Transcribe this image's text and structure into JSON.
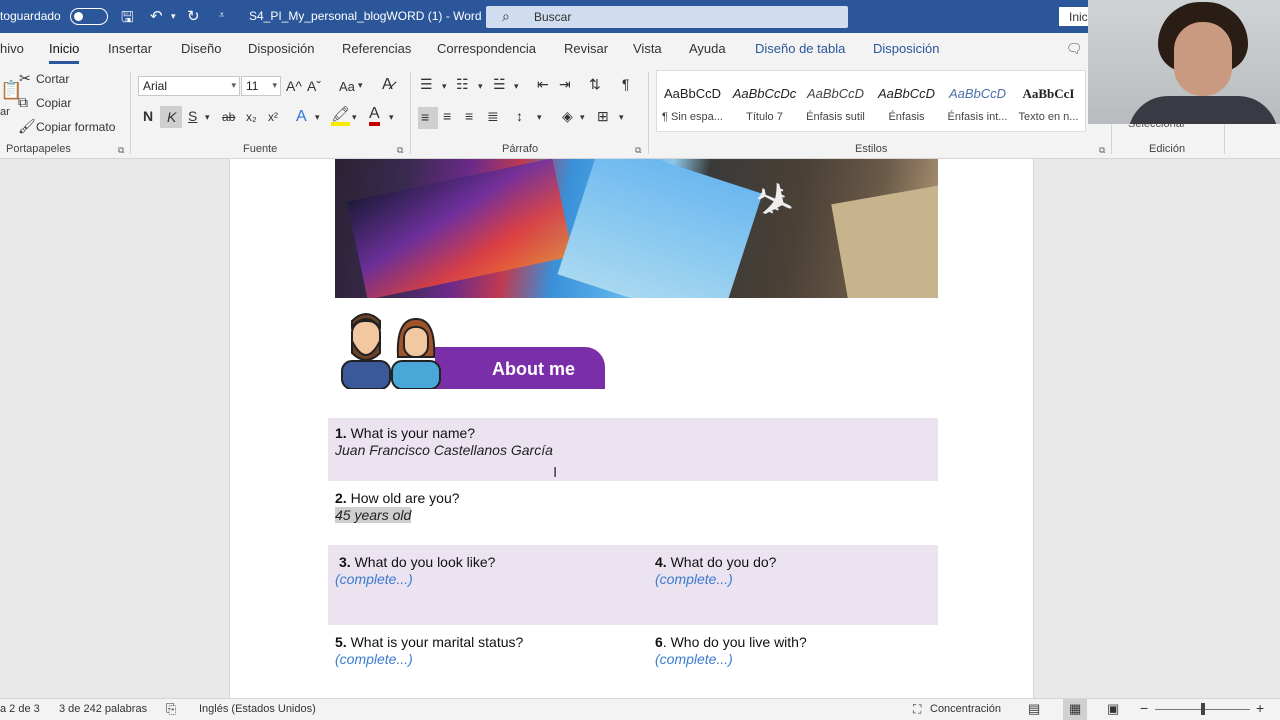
{
  "titlebar": {
    "autosave_label": "toguardado",
    "doc_title": "S4_PI_My_personal_blogWORD (1)  -  Word",
    "search_placeholder": "Buscar",
    "signin_label": "Inic"
  },
  "tabs": [
    {
      "label": "hivo"
    },
    {
      "label": "Inicio"
    },
    {
      "label": "Insertar"
    },
    {
      "label": "Diseño"
    },
    {
      "label": "Disposición"
    },
    {
      "label": "Referencias"
    },
    {
      "label": "Correspondencia"
    },
    {
      "label": "Revisar"
    },
    {
      "label": "Vista"
    },
    {
      "label": "Ayuda"
    },
    {
      "label": "Diseño de tabla"
    },
    {
      "label": "Disposición"
    }
  ],
  "ribbon": {
    "clipboard": {
      "paste_label": "ar",
      "cut": "Cortar",
      "copy": "Copiar",
      "format_painter": "Copiar formato",
      "group": "Portapapeles"
    },
    "font": {
      "name": "Arial",
      "size": "11",
      "grow": "A^",
      "shrink": "Aˇ",
      "case": "Aa",
      "bold": "N",
      "italic": "K",
      "underline": "S",
      "strike": "ab",
      "subscript": "x₂",
      "superscript": "x²",
      "group": "Fuente"
    },
    "paragraph": {
      "group": "Párrafo"
    },
    "styles": {
      "group": "Estilos",
      "items": [
        {
          "preview": "AaBbCcD",
          "name": "¶ Sin espa..."
        },
        {
          "preview": "AaBbCcDc",
          "name": "Título 7"
        },
        {
          "preview": "AaBbCcD",
          "name": "Énfasis sutil"
        },
        {
          "preview": "AaBbCcD",
          "name": "Énfasis"
        },
        {
          "preview": "AaBbCcD",
          "name": "Énfasis int..."
        },
        {
          "preview": "AaBbCcI",
          "name": "Texto en n..."
        }
      ]
    },
    "editing": {
      "select_label": "Seleccionar",
      "group": "Edición"
    }
  },
  "document": {
    "about_title": "About me",
    "q1": {
      "num": "1.",
      "text": " What is your name?",
      "answer": "Juan Francisco Castellanos García"
    },
    "q2": {
      "num": "2.",
      "text": " How old are you?",
      "answer": "45 years old "
    },
    "q3": {
      "num": "3.",
      "text": " What do you look like?",
      "answer": "(complete...)"
    },
    "q4": {
      "num": "4.",
      "text": " What do you do?",
      "answer": "(complete...)"
    },
    "q5": {
      "num": "5.",
      "text": " What is your marital status?",
      "answer": "(complete...)"
    },
    "q6": {
      "num": "6",
      "text": ". Who do you live with?",
      "answer": "(complete...)"
    }
  },
  "statusbar": {
    "page": "a 2 de 3",
    "words": "3 de 242 palabras",
    "language": "Inglés (Estados Unidos)",
    "focus": "Concentración"
  }
}
